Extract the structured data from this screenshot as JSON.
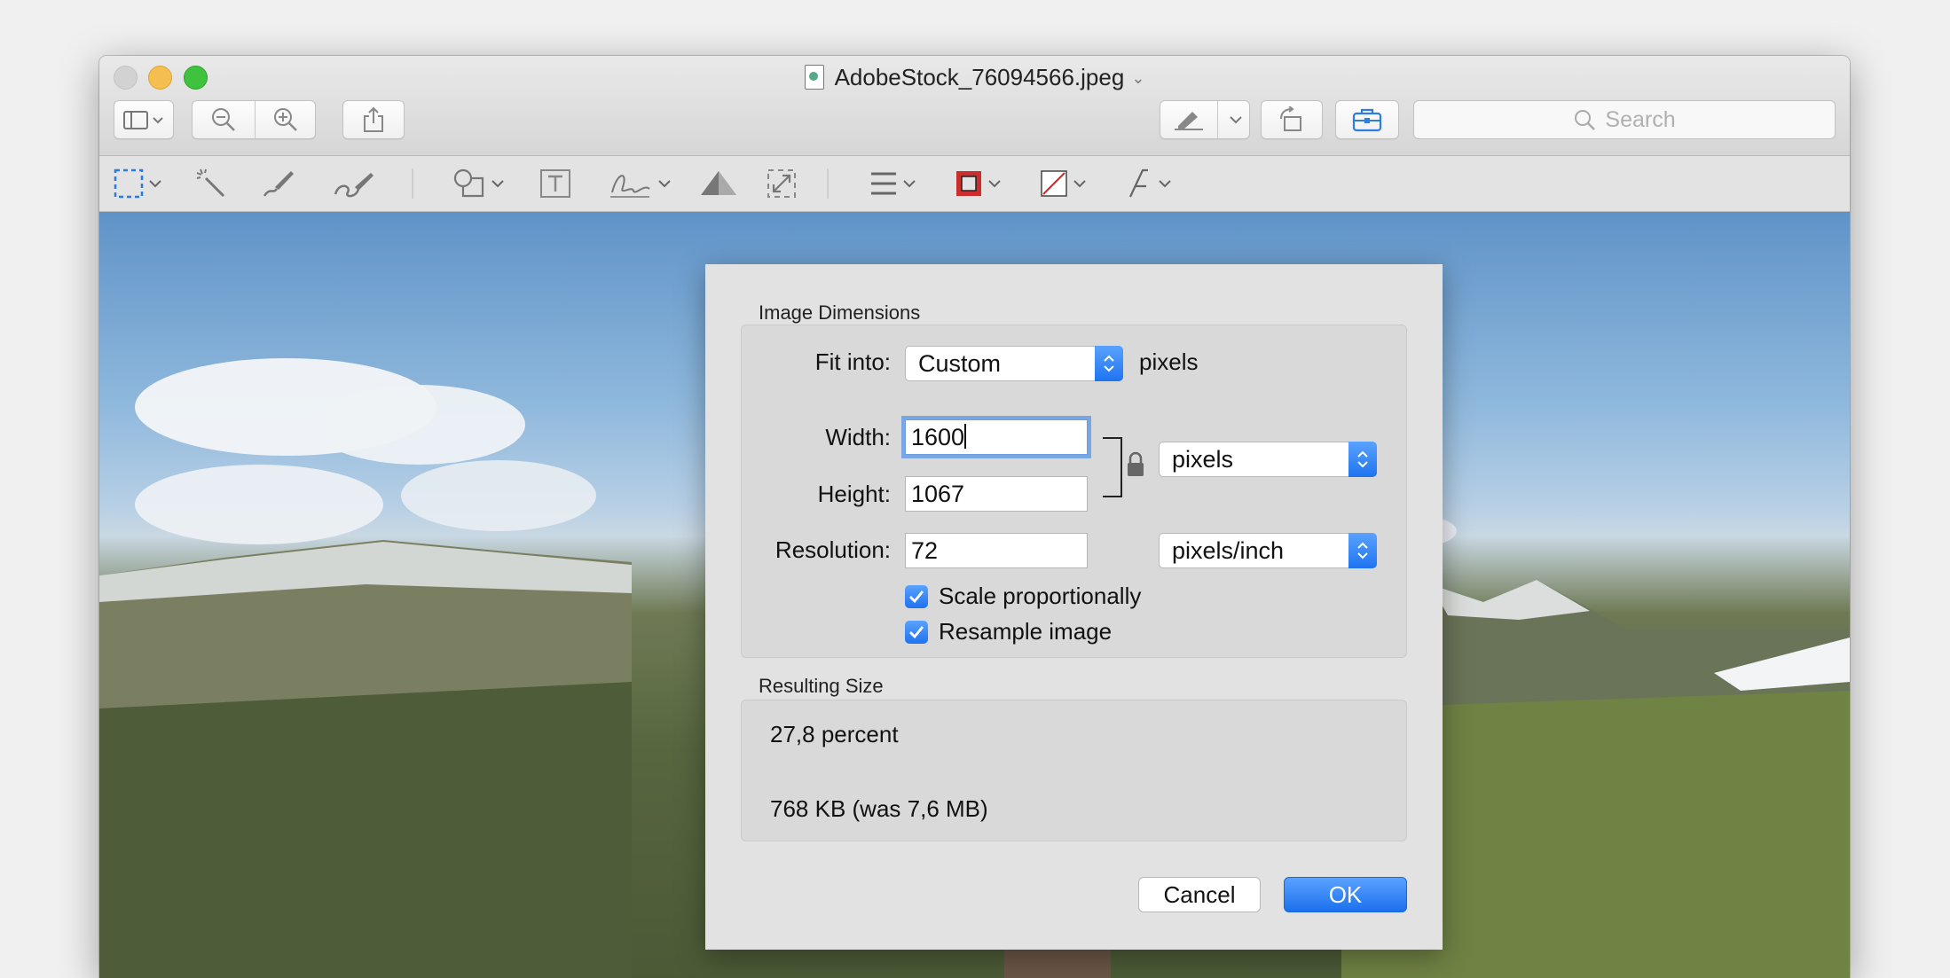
{
  "window": {
    "title": "AdobeStock_76094566.jpeg"
  },
  "toolbar": {
    "search_placeholder": "Search"
  },
  "dialog": {
    "image_dimensions_title": "Image Dimensions",
    "fit_into_label": "Fit into:",
    "fit_into_value": "Custom",
    "fit_into_unit": "pixels",
    "width_label": "Width:",
    "width_value": "1600",
    "height_label": "Height:",
    "height_value": "1067",
    "size_unit": "pixels",
    "resolution_label": "Resolution:",
    "resolution_value": "72",
    "resolution_unit": "pixels/inch",
    "scale_proportionally": "Scale proportionally",
    "resample_image": "Resample image",
    "resulting_size_title": "Resulting Size",
    "result_percent": "27,8 percent",
    "result_size": "768 KB (was 7,6 MB)",
    "cancel_label": "Cancel",
    "ok_label": "OK"
  },
  "colors": {
    "accent": "#1f73ef"
  }
}
